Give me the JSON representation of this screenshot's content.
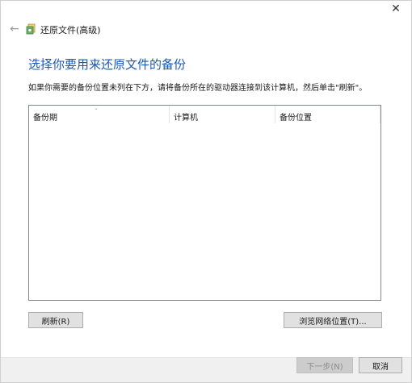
{
  "window": {
    "close_glyph": "✕",
    "back_glyph": "←",
    "title": "还原文件(高级)"
  },
  "page": {
    "heading": "选择你要用来还原文件的备份",
    "instruction": "如果你需要的备份位置未列在下方，请将备份所在的驱动器连接到该计算机，然后单击\"刷新\"。"
  },
  "list": {
    "columns": [
      {
        "label": "备份期"
      },
      {
        "label": "计算机"
      },
      {
        "label": "备份位置"
      }
    ],
    "rows": []
  },
  "buttons": {
    "refresh": "刷新(R)",
    "browse_network": "浏览网络位置(T)...",
    "next": "下一步(N)",
    "cancel": "取消"
  },
  "colors": {
    "heading": "#1b57b8",
    "button_bg": "#e1e1e1",
    "disabled_button_bg": "#cccccc",
    "footer_bg": "#f0f0f0"
  }
}
